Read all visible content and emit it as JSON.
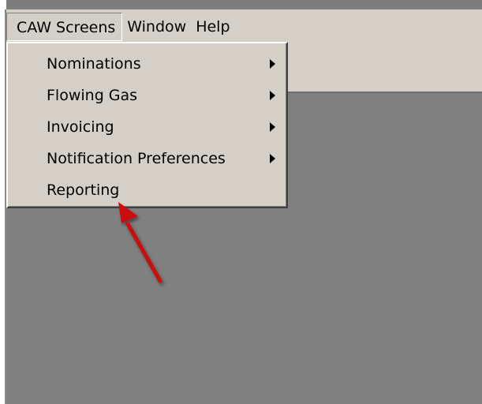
{
  "menubar": {
    "items": [
      {
        "label": "CAW Screens"
      },
      {
        "label": "Window"
      },
      {
        "label": "Help"
      }
    ]
  },
  "dropdown": {
    "items": [
      {
        "label": "Nominations",
        "has_submenu": true
      },
      {
        "label": "Flowing Gas",
        "has_submenu": true
      },
      {
        "label": "Invoicing",
        "has_submenu": true
      },
      {
        "label": "Notification Preferences",
        "has_submenu": true
      },
      {
        "label": "Reporting",
        "has_submenu": false
      }
    ]
  },
  "annotation": {
    "icon": "red-pointer-arrow-icon",
    "color": "#cc1111"
  },
  "colors": {
    "menu_background": "#d4d0c8",
    "workspace": "#808080"
  }
}
